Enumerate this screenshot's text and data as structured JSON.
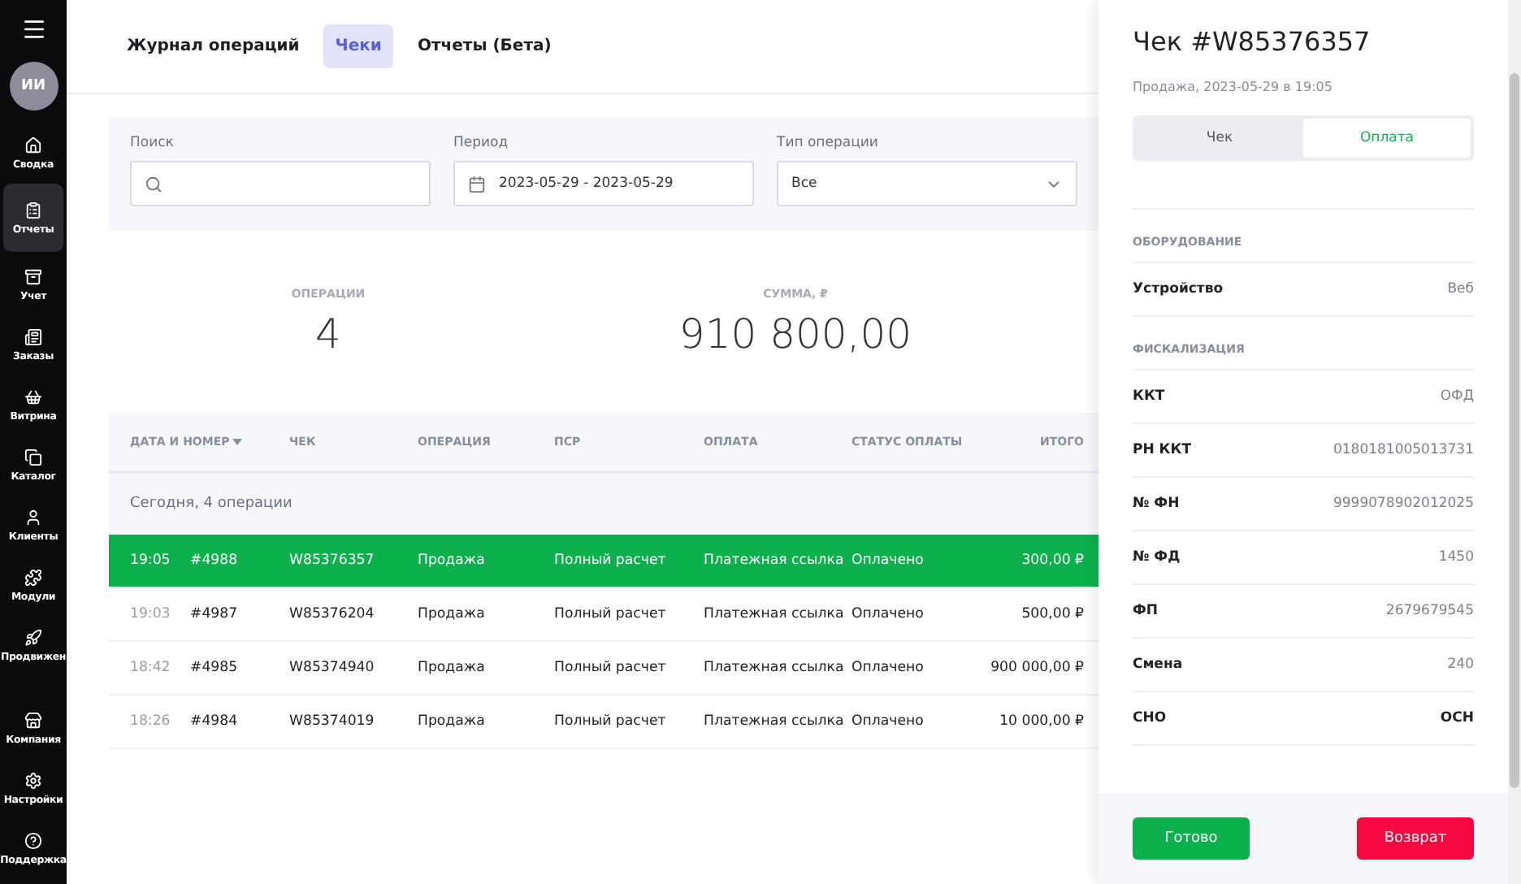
{
  "sidebar": {
    "avatar": "ИИ",
    "items": [
      {
        "label": "Сводка",
        "selected": false
      },
      {
        "label": "Отчеты",
        "selected": true
      },
      {
        "label": "Учет",
        "selected": false
      },
      {
        "label": "Заказы",
        "selected": false
      },
      {
        "label": "Витрина",
        "selected": false
      },
      {
        "label": "Каталог",
        "selected": false
      },
      {
        "label": "Клиенты",
        "selected": false
      },
      {
        "label": "Модули",
        "selected": false
      },
      {
        "label": "Продвижен",
        "selected": false
      },
      {
        "label": "Компания",
        "selected": false
      },
      {
        "label": "Настройки",
        "selected": false
      },
      {
        "label": "Поддержка",
        "selected": false
      }
    ]
  },
  "tabs": [
    {
      "label": "Журнал операций",
      "selected": false
    },
    {
      "label": "Чеки",
      "selected": true
    },
    {
      "label": "Отчеты (Бета)",
      "selected": false
    }
  ],
  "filters": {
    "search": {
      "label": "Поиск"
    },
    "period": {
      "label": "Период",
      "value": "2023-05-29 - 2023-05-29"
    },
    "type": {
      "label": "Тип операции",
      "value": "Все"
    }
  },
  "stats": [
    {
      "label": "ОПЕРАЦИИ",
      "value": "4"
    },
    {
      "label": "СУММА, ₽",
      "value": "910 800,00"
    }
  ],
  "table": {
    "columns": [
      "ДАТА И НОМЕР",
      "ЧЕК",
      "ОПЕРАЦИЯ",
      "ПСР",
      "ОПЛАТА",
      "СТАТУС ОПЛАТЫ",
      "ИТОГО"
    ],
    "group": "Сегодня, 4 операции",
    "rows": [
      {
        "time": "19:05",
        "number": "#4988",
        "check": "W85376357",
        "operation": "Продажа",
        "psr": "Полный расчет",
        "payment": "Платежная ссылка",
        "status": "Оплачено",
        "total": "300,00 ₽",
        "selected": true
      },
      {
        "time": "19:03",
        "number": "#4987",
        "check": "W85376204",
        "operation": "Продажа",
        "psr": "Полный расчет",
        "payment": "Платежная ссылка",
        "status": "Оплачено",
        "total": "500,00 ₽",
        "selected": false
      },
      {
        "time": "18:42",
        "number": "#4985",
        "check": "W85374940",
        "operation": "Продажа",
        "psr": "Полный расчет",
        "payment": "Платежная ссылка",
        "status": "Оплачено",
        "total": "900 000,00 ₽",
        "selected": false
      },
      {
        "time": "18:26",
        "number": "#4984",
        "check": "W85374019",
        "operation": "Продажа",
        "psr": "Полный расчет",
        "payment": "Платежная ссылка",
        "status": "Оплачено",
        "total": "10 000,00 ₽",
        "selected": false
      }
    ]
  },
  "panel": {
    "title": "Чек #W85376357",
    "subtitle": "Продажа, 2023-05-29 в 19:05",
    "segments": [
      {
        "label": "Чек",
        "selected": false
      },
      {
        "label": "Оплата",
        "selected": true
      }
    ],
    "sections": [
      {
        "title": "ОБОРУДОВАНИЕ",
        "rows": [
          {
            "label": "Устройство",
            "value": "Веб",
            "strong": false
          }
        ]
      },
      {
        "title": "ФИСКАЛИЗАЦИЯ",
        "rows": [
          {
            "label": "ККТ",
            "value": "ОФД",
            "strong": false
          },
          {
            "label": "РН ККТ",
            "value": "0180181005013731",
            "strong": false
          },
          {
            "label": "№ ФН",
            "value": "9999078902012025",
            "strong": false
          },
          {
            "label": "№ ФД",
            "value": "1450",
            "strong": false
          },
          {
            "label": "ФП",
            "value": "2679679545",
            "strong": false
          },
          {
            "label": "Смена",
            "value": "240",
            "strong": false
          },
          {
            "label": "СНО",
            "value": "ОСН",
            "strong": true
          }
        ]
      }
    ],
    "buttons": {
      "done": "Готово",
      "refund": "Возврат"
    }
  }
}
